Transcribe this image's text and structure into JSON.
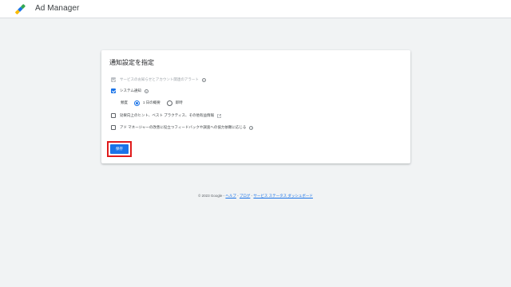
{
  "header": {
    "app_title": "Ad Manager",
    "logo_colors": [
      "#fbbc04",
      "#1a73e8",
      "#34a853"
    ]
  },
  "settings_card": {
    "title": "通知設定を指定",
    "options": [
      {
        "label": "サービスのお知らせとアカウント関連のアラート",
        "checked": true,
        "disabled": true,
        "has_help": true
      },
      {
        "label": "システム通知",
        "checked": true,
        "disabled": false,
        "has_help": true
      },
      {
        "label": "効果向上のヒント、ベスト プラクティス、その他有益情報",
        "checked": false,
        "disabled": false,
        "has_external_link": true
      },
      {
        "label": "アド マネージャーの改善に役立つフィードバックや調査への協力依頼に応じる",
        "checked": false,
        "disabled": false,
        "has_help": true
      }
    ],
    "frequency": {
      "label": "頻度",
      "options": [
        {
          "label": "1 日の概要",
          "selected": true
        },
        {
          "label": "即時",
          "selected": false
        }
      ]
    },
    "save_label": "保存",
    "accent_color": "#1a73e8",
    "highlight_color": "#e01b1b"
  },
  "footer": {
    "copyright": "© 2023 Google",
    "separator": " - ",
    "links": [
      "ヘルプ",
      "ブログ",
      "サービス ステータス ダッシュボード"
    ]
  }
}
